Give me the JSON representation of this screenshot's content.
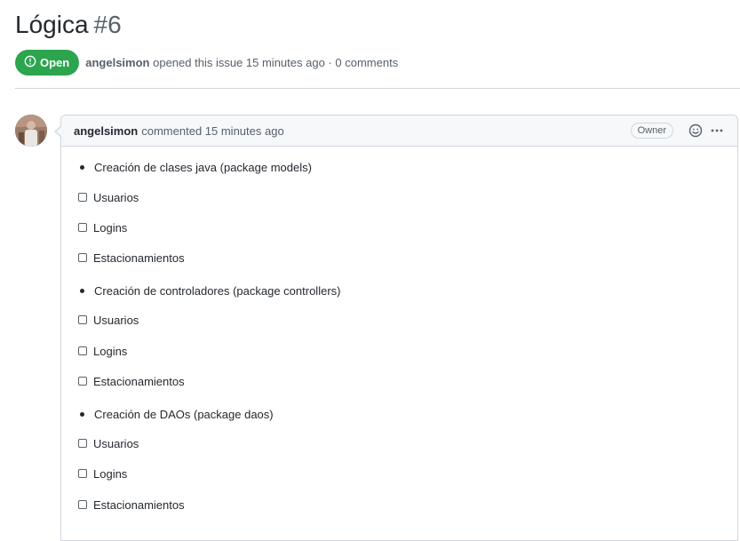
{
  "issue": {
    "title": "Lógica",
    "number": "#6",
    "state": "Open",
    "author": "angelsimon",
    "opened_text": "opened this issue 15 minutes ago",
    "separator": "·",
    "comments_text": "0 comments"
  },
  "comment": {
    "author": "angelsimon",
    "action_text": "commented 15 minutes ago",
    "role_label": "Owner",
    "sections": [
      {
        "bullet": "Creación de clases java (package models)",
        "tasks": [
          "Usuarios",
          "Logins",
          "Estacionamientos"
        ]
      },
      {
        "bullet": "Creación de controladores (package controllers)",
        "tasks": [
          "Usuarios",
          "Logins",
          "Estacionamientos"
        ]
      },
      {
        "bullet": "Creación de DAOs (package daos)",
        "tasks": [
          "Usuarios",
          "Logins",
          "Estacionamientos"
        ]
      }
    ]
  },
  "icons": {
    "state": "issue-opened-icon",
    "reaction": "smiley-icon",
    "menu": "kebab-horizontal-icon"
  },
  "colors": {
    "open_green": "#2da44e",
    "text": "#24292f",
    "muted": "#57606a",
    "border": "#d0d7de",
    "header_bg": "#f6f8fa"
  }
}
